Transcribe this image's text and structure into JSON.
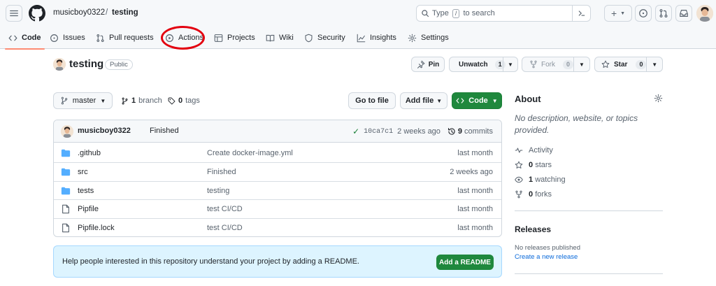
{
  "header": {
    "owner": "musicboy0322",
    "separator": "/",
    "repo": "testing",
    "search": {
      "prefix": "Type",
      "key": "/",
      "suffix": "to search"
    }
  },
  "tabs": [
    {
      "label": "Code",
      "icon": "code-icon",
      "active": true
    },
    {
      "label": "Issues",
      "icon": "issue-opened-icon"
    },
    {
      "label": "Pull requests",
      "icon": "git-pull-request-icon"
    },
    {
      "label": "Actions",
      "icon": "play-icon"
    },
    {
      "label": "Projects",
      "icon": "table-icon"
    },
    {
      "label": "Wiki",
      "icon": "book-icon"
    },
    {
      "label": "Security",
      "icon": "shield-icon"
    },
    {
      "label": "Insights",
      "icon": "graph-icon"
    },
    {
      "label": "Settings",
      "icon": "gear-icon"
    }
  ],
  "repo_header": {
    "name": "testing",
    "visibility": "Public",
    "pin_label": "Pin",
    "unwatch_label": "Unwatch",
    "unwatch_count": "1",
    "fork_label": "Fork",
    "fork_count": "0",
    "star_label": "Star",
    "star_count": "0"
  },
  "branch_bar": {
    "branch": "master",
    "branch_count": "1",
    "branch_word": "branch",
    "tag_count": "0",
    "tag_word": "tags",
    "go_to_file": "Go to file",
    "add_file": "Add file",
    "code": "Code"
  },
  "latest_commit": {
    "user": "musicboy0322",
    "message": "Finished",
    "sha": "10ca7c1",
    "time": "2 weeks ago",
    "commit_count": "9",
    "commit_word": "commits"
  },
  "files": [
    {
      "name": ".github",
      "type": "dir",
      "message": "Create docker-image.yml",
      "date": "last month"
    },
    {
      "name": "src",
      "type": "dir",
      "message": "Finished",
      "date": "2 weeks ago"
    },
    {
      "name": "tests",
      "type": "dir",
      "message": "testing",
      "date": "last month"
    },
    {
      "name": "Pipfile",
      "type": "file",
      "message": "test CI/CD",
      "date": "last month"
    },
    {
      "name": "Pipfile.lock",
      "type": "file",
      "message": "test CI/CD",
      "date": "last month"
    }
  ],
  "readme_banner": {
    "text": "Help people interested in this repository understand your project by adding a README.",
    "button": "Add a README"
  },
  "about": {
    "title": "About",
    "description": "No description, website, or topics provided.",
    "activity": "Activity",
    "stars_count": "0",
    "stars_word": "stars",
    "watching_count": "1",
    "watching_word": "watching",
    "forks_count": "0",
    "forks_word": "forks"
  },
  "releases": {
    "title": "Releases",
    "none": "No releases published",
    "create_link": "Create a new release"
  },
  "colors": {
    "accent_green": "#1f883d",
    "link_blue": "#0969da",
    "annotation_red": "#e3000f",
    "tab_underline": "#fd8c73"
  }
}
